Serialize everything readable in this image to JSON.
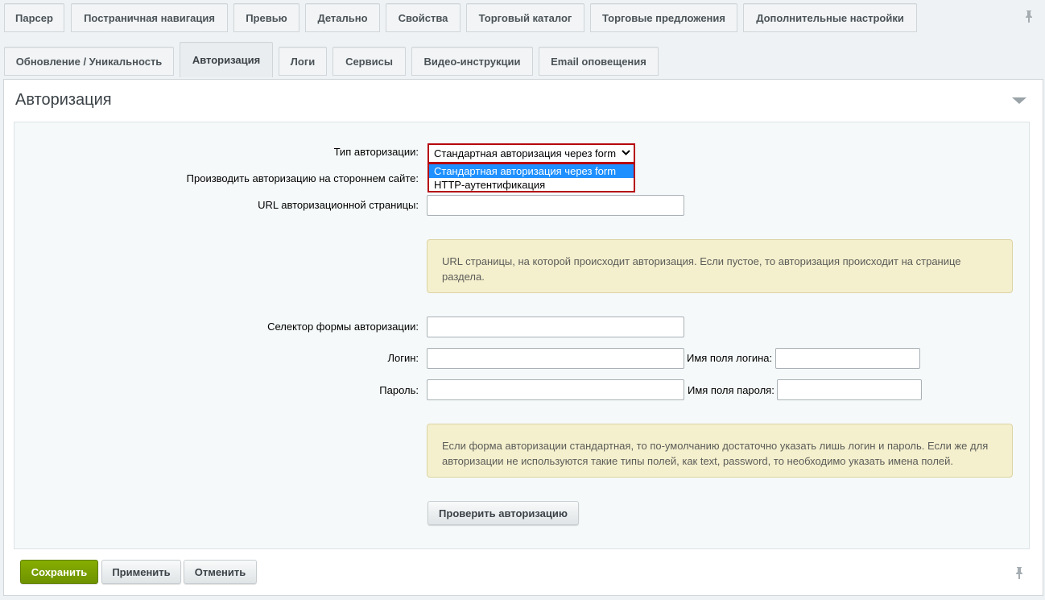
{
  "tabs_row1": [
    "Парсер",
    "Постраничная навигация",
    "Превью",
    "Детально",
    "Свойства",
    "Торговый каталог",
    "Торговые предложения",
    "Дополнительные настройки"
  ],
  "tabs_row2": [
    "Обновление / Уникальность",
    "Авторизация",
    "Логи",
    "Сервисы",
    "Видео-инструкции",
    "Email оповещения"
  ],
  "active_tab": "Авторизация",
  "panel": {
    "title": "Авторизация"
  },
  "form": {
    "auth_type_label": "Тип авторизации:",
    "auth_type_value": "Стандартная авторизация через form",
    "auth_type_options": [
      "Стандартная авторизация через form",
      "HTTP-аутентификация"
    ],
    "third_party_label": "Производить авторизацию на стороннем сайте:",
    "url_label": "URL авторизационной страницы:",
    "url_value": "",
    "url_note": "URL страницы, на которой происходит авторизация. Если пустое, то авторизация происходит на странице раздела.",
    "selector_label": "Селектор формы авторизации:",
    "selector_value": "",
    "login_label": "Логин:",
    "login_value": "",
    "login_field_name_label": "Имя поля логина:",
    "login_field_name_value": "",
    "password_label": "Пароль:",
    "password_value": "",
    "password_field_name_label": "Имя поля пароля:",
    "password_field_name_value": "",
    "fields_note": "Если форма авторизации стандартная, то по-умолчанию достаточно указать лишь логин и пароль. Если же для авторизации не используются такие типы полей, как text, password, то необходимо указать имена полей.",
    "check_button": "Проверить авторизацию"
  },
  "footer": {
    "save": "Сохранить",
    "apply": "Применить",
    "cancel": "Отменить"
  },
  "colors": {
    "accent_red": "#b6000b",
    "save_green": "#7a9e00",
    "note_bg": "#f4efcd",
    "selected_option": "#1e90ff"
  },
  "icons": {
    "pin": "pin-icon",
    "collapse": "chevron-down-icon"
  }
}
